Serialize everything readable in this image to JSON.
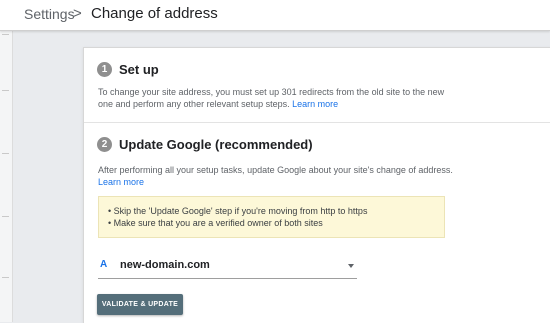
{
  "breadcrumb": {
    "parent": "Settings",
    "separator": ">",
    "current": "Change of address"
  },
  "step1": {
    "number": "1",
    "title": "Set up",
    "description_line1": "To change your site address, you must set up 301 redirects from the old site to the new",
    "description_line2": "one and perform any other relevant setup steps.",
    "link": "Learn more"
  },
  "step2": {
    "number": "2",
    "title": "Update Google (recommended)",
    "description_line1": "After performing all your setup tasks, update Google about your site's change of address.",
    "link": "Learn more",
    "notice": [
      "• Skip the 'Update Google' step if you're moving from http to https",
      "• Make sure that you are a verified owner of both sites"
    ],
    "site_select": {
      "icon_letter": "A",
      "value": "new-domain.com"
    },
    "button_label": "VALIDATE & UPDATE"
  },
  "colors": {
    "button": "#546e7a",
    "link": "#1a73e8",
    "notice_bg": "#fdf8d8",
    "step_circle": "#8f8f8f"
  }
}
